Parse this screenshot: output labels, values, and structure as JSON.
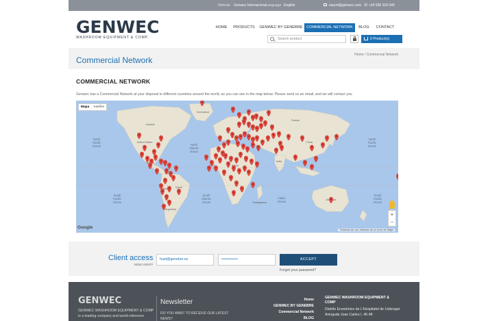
{
  "topbar": {
    "website_label": "Website",
    "website_value": "Genwec Internacional",
    "language_label": "Language",
    "language_value": "English",
    "email": "export@genwec.com",
    "phone": "+34 936 318 040"
  },
  "logo": {
    "word": "GENWEC",
    "tagline": "WASHROOM EQUIPMENT & COMP."
  },
  "nav": {
    "items": [
      {
        "label": "HOME"
      },
      {
        "label": "PRODUCTS"
      },
      {
        "label": "GENWEC BY GENEBRE"
      },
      {
        "label": "COMMERCIAL NETWORK"
      },
      {
        "label": "BLOG"
      },
      {
        "label": "CONTACT"
      }
    ]
  },
  "search": {
    "placeholder": "Search product"
  },
  "cart": {
    "label": "0 Product(s)"
  },
  "page": {
    "title": "Commercial Network",
    "breadcrumb": "Home / Commercial Network",
    "section_title": "COMMERCIAL NETWORK",
    "intro": "Genwec has a Commercial Network at your disposal in different countries around the world, as you can see in the map below. Please send us an email, and we will contact you."
  },
  "map": {
    "type_map": "Mapa",
    "type_satellite": "Satélite",
    "google": "Google",
    "footer": "Términos de uso   Informar de un error de Maps",
    "zoom_in": "+",
    "zoom_out": "−",
    "labels": {
      "north_pacific": "North\nPacific\nOcean",
      "north_atlantic": "North\nAtlantic\nOcean",
      "south_pacific": "South\nPacific\nOcean",
      "south_atlantic": "South\nAtlantic\nOcean",
      "indian": "Indian\nOcean",
      "greenland": "Greenland",
      "australia": "Australia",
      "brazil": "Brazil",
      "argentina": "Argentina",
      "russia": "Russia",
      "china": "China",
      "india": "India",
      "canada": "Canada",
      "united_states": "United States",
      "africa": "Africa",
      "madagascar": "Madagascar",
      "mexico": "Mexico",
      "peru": "Peru",
      "north_pacific_r": "North\nPacific\nOcean",
      "south_pacific_r": "South\nPacific\nOcean"
    },
    "marker_color": "#e8453c"
  },
  "login": {
    "title": "Client access",
    "new_user": "NEW USER?",
    "email_value": "huet@genebre.es",
    "password_value": "••••••••••••",
    "accept": "ACCEPT",
    "forgot": "Forgot your password?"
  },
  "footer": {
    "logo": "GENWEC",
    "desc": "GENWEC WASHROOM EQUIPMENT & COMP is a leading company and world reference",
    "newsletter_title": "Newsletter",
    "newsletter_question": "DO YOU WANT TO RECEIVE OUR LATEST NEWS?",
    "links": [
      "Home",
      "GENWEC BY GENEBRE",
      "Commercial Network",
      "BLOG"
    ],
    "company": "GENWEC WASHROOM EQUIPMENT & COMP",
    "address": "Distrito Económico de L'Hospitalet de Llobregat\nAvinguda Joan Carles I, 46-48"
  },
  "colors": {
    "primary": "#1b6fb3",
    "topbar": "#8a9199",
    "footer": "#4c5258",
    "accept": "#1f4f79"
  }
}
